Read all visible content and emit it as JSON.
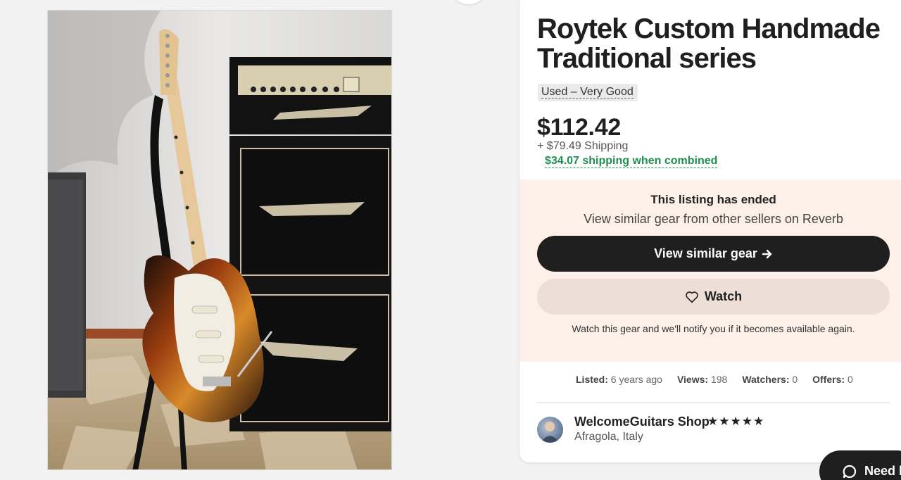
{
  "listing": {
    "title": "Roytek Custom Handmade Traditional series",
    "condition": "Used – Very Good",
    "price": "$112.42",
    "shipping": "+ $79.49 Shipping",
    "combined_shipping": "$34.07 shipping when combined"
  },
  "ended": {
    "title": "This listing has ended",
    "subtitle": "View similar gear from other sellers on Reverb",
    "similar_button": "View similar gear",
    "watch_button": "Watch",
    "watch_note": "Watch this gear and we'll notify you if it becomes available again."
  },
  "stats": [
    {
      "label": "Listed:",
      "value": "6 years ago"
    },
    {
      "label": "Views:",
      "value": "198"
    },
    {
      "label": "Watchers:",
      "value": "0"
    },
    {
      "label": "Offers:",
      "value": "0"
    }
  ],
  "seller": {
    "name": "WelcomeGuitars Shop",
    "rating_stars": "★★★★★",
    "location": "Afragola, Italy"
  },
  "help": {
    "label": "Need h"
  },
  "icons": {
    "arrow": "arrow-right-icon",
    "heart": "heart-icon",
    "chat": "chat-bubble-icon",
    "star": "star-icon"
  },
  "colors": {
    "accent_green": "#1f8f4f",
    "ended_bg": "#fdf0e8",
    "dark_button": "#1f1f1f",
    "watch_button": "#eddfd6"
  }
}
